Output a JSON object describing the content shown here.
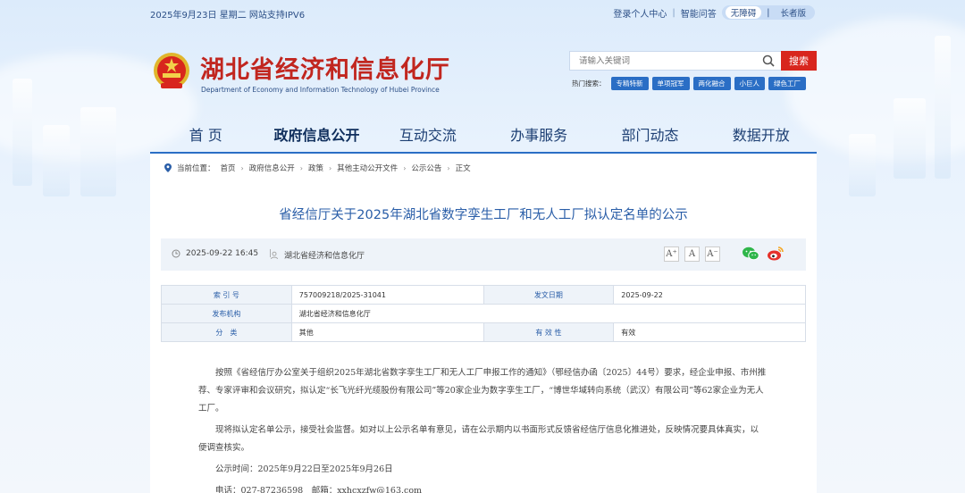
{
  "topbar": {
    "date": "2025年9月23日 星期二",
    "ipv6": "网站支持IPV6",
    "login": "登录个人中心",
    "qa": "智能问答",
    "mode_normal": "无障碍",
    "mode_elder": "长者版"
  },
  "header": {
    "title": "湖北省经济和信息化厅",
    "subtitle_en": "Department of Economy and Information Technology of Hubei Province",
    "search_placeholder": "请输入关键词",
    "search_button": "搜索",
    "hot_label": "热门搜索：",
    "hot_tags": [
      "专精特新",
      "单项冠军",
      "两化融合",
      "小巨人",
      "绿色工厂"
    ]
  },
  "nav": [
    "首 页",
    "政府信息公开",
    "互动交流",
    "办事服务",
    "部门动态",
    "数据开放"
  ],
  "breadcrumb": {
    "label": "当前位置：",
    "items": [
      "首页",
      "政府信息公开",
      "政策",
      "其他主动公开文件",
      "公示公告",
      "正文"
    ]
  },
  "article": {
    "title": "省经信厅关于2025年湖北省数字孪生工厂和无人工厂拟认定名单的公示",
    "datetime": "2025-09-22 16:45",
    "source": "湖北省经济和信息化厅",
    "font_sizes": [
      "A⁺",
      "A",
      "A⁻"
    ]
  },
  "info_table": {
    "index_label": "索 引 号",
    "index_value": "757009218/2025-31041",
    "date_label": "发文日期",
    "date_value": "2025-09-22",
    "org_label": "发布机构",
    "org_value": "湖北省经济和信息化厅",
    "cat_label": "分　类",
    "cat_value": "其他",
    "valid_label": "有 效 性",
    "valid_value": "有效"
  },
  "body": {
    "p1": "按照《省经信厅办公室关于组织2025年湖北省数字孪生工厂和无人工厂申报工作的通知》（鄂经信办函〔2025〕44号）要求，经企业申报、市州推荐、专家评审和会议研究，拟认定“长飞光纤光缆股份有限公司”等20家企业为数字孪生工厂，“博世华域转向系统（武汉）有限公司”等62家企业为无人工厂。",
    "p2": "现将拟认定名单公示，接受社会监督。如对以上公示名单有意见，请在公示期内以书面形式反馈省经信厅信息化推进处，反映情况要具体真实，以便调查核实。",
    "p3": "公示时间：2025年9月22日至2025年9月26日",
    "p4": "电话：027-87236598　邮箱：xxhcxzfw@163.com"
  }
}
